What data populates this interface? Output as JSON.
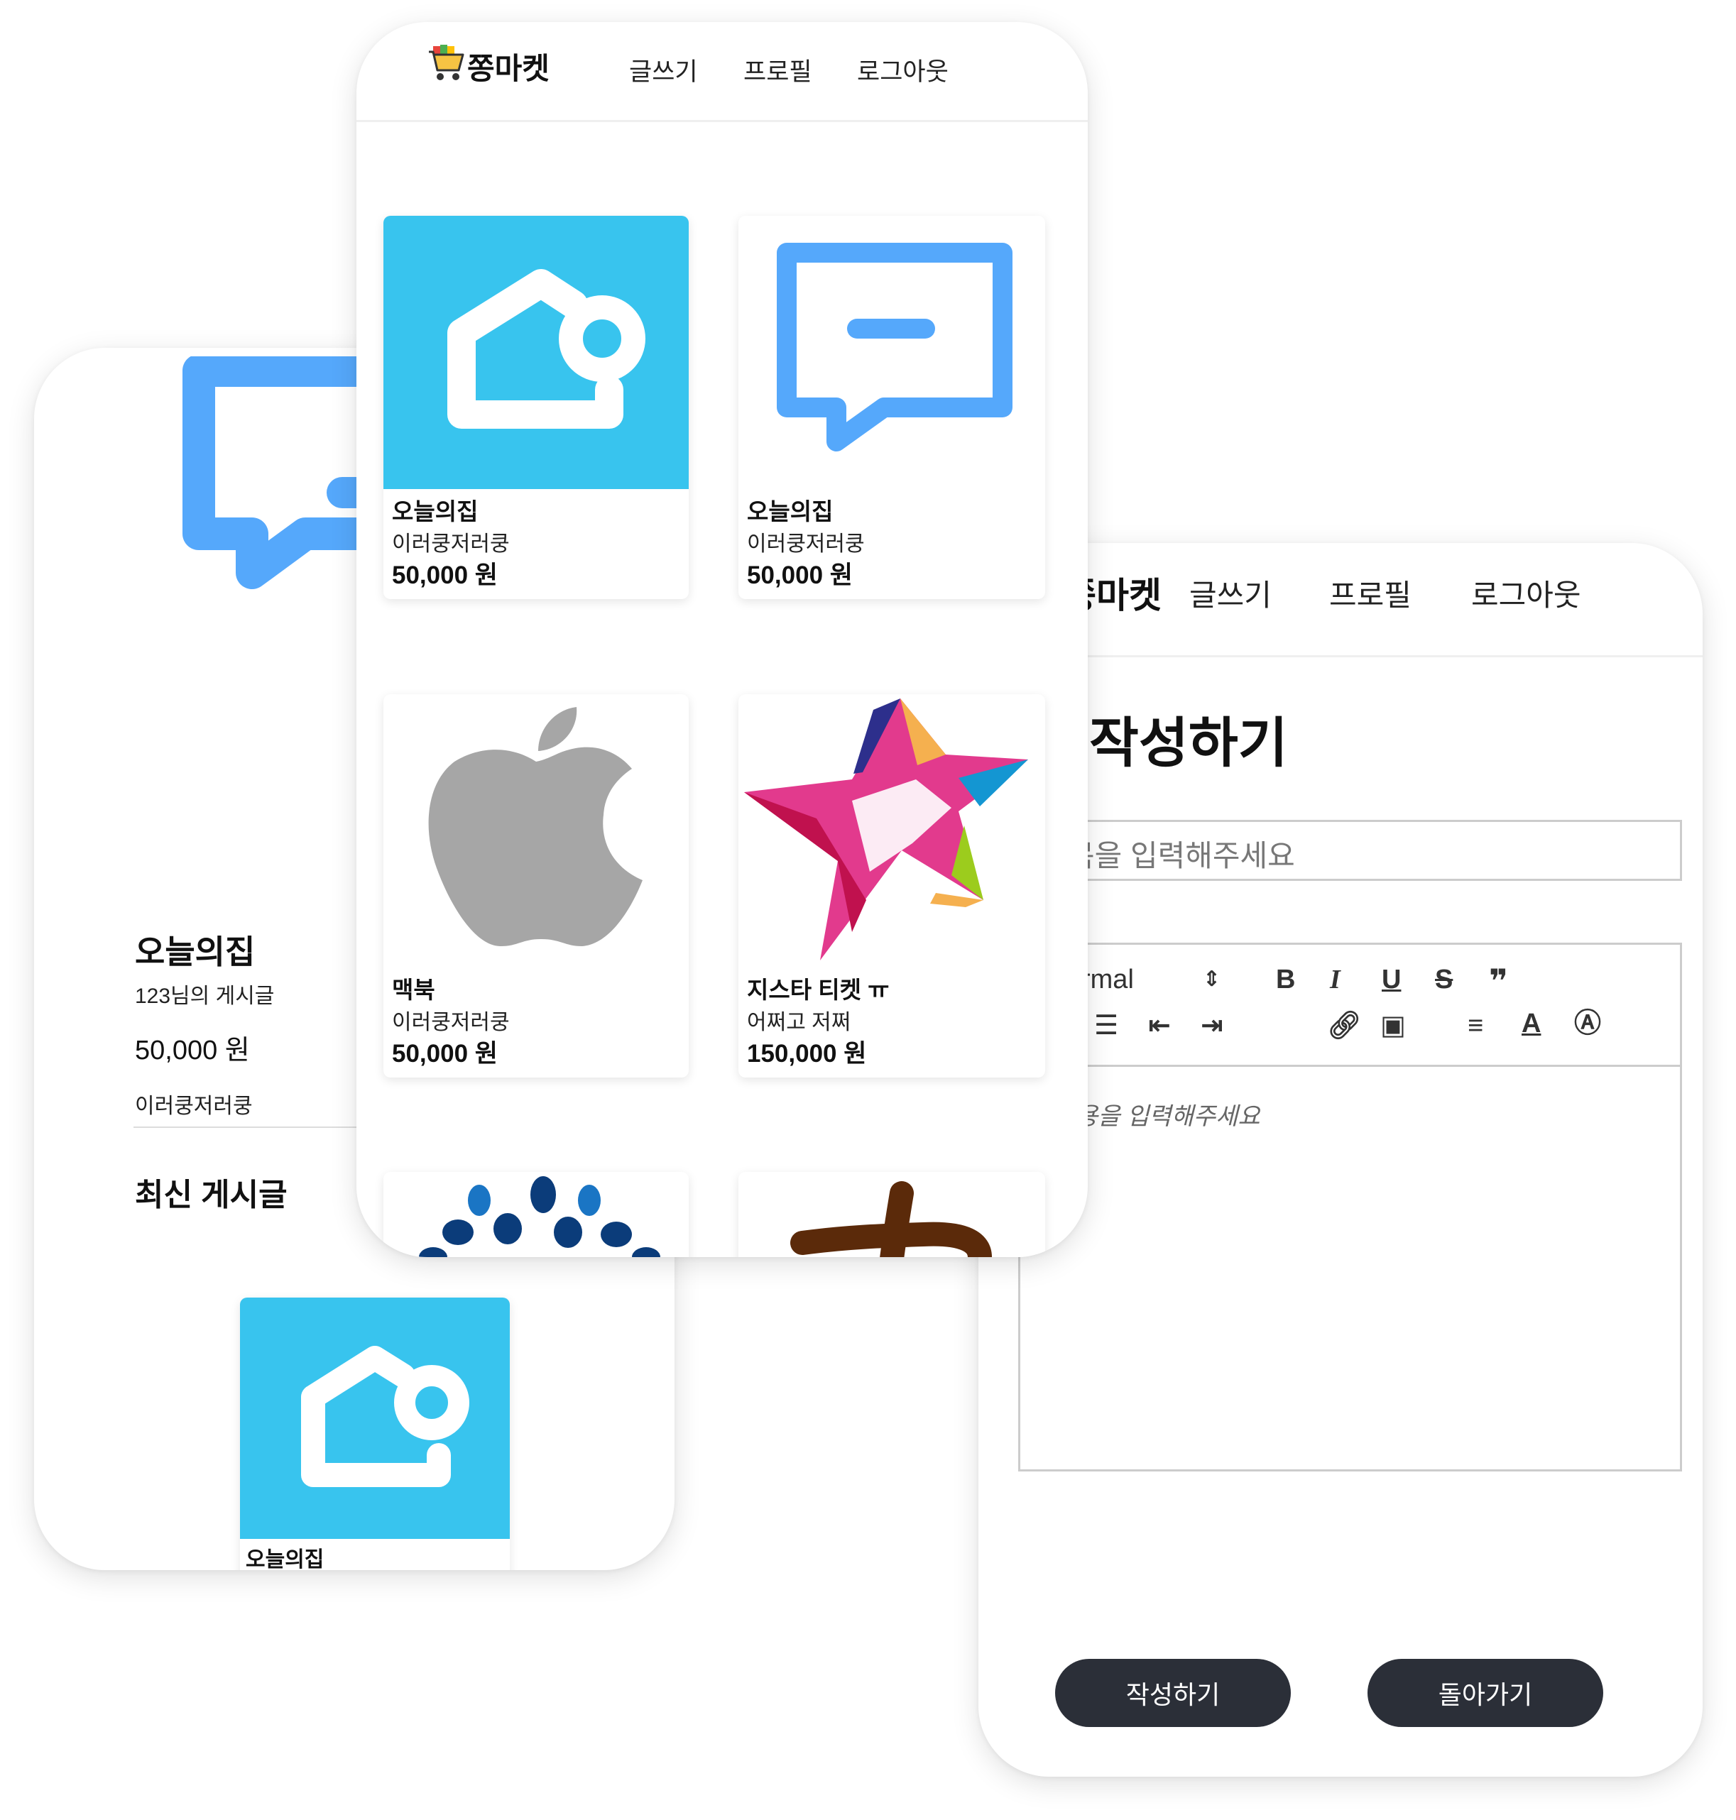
{
  "brand": {
    "name": "쫑마켓"
  },
  "nav": {
    "write": "글쓰기",
    "profile": "프로필",
    "logout": "로그아웃"
  },
  "list_page": {
    "cards": [
      {
        "title": "오늘의집",
        "subtitle": "이러쿵저러쿵",
        "price": "50,000 원",
        "image": "house-logo"
      },
      {
        "title": "오늘의집",
        "subtitle": "이러쿵저러쿵",
        "price": "50,000 원",
        "image": "chat-bubble-logo"
      },
      {
        "title": "맥북",
        "subtitle": "이러쿵저러쿵",
        "price": "50,000 원",
        "image": "apple-logo"
      },
      {
        "title": "지스타 티켓 ㅠ",
        "subtitle": "어쩌고 저쩌",
        "price": "150,000 원",
        "image": "star-logo"
      }
    ]
  },
  "detail_page": {
    "title": "오늘의집",
    "author": "123님의 게시글",
    "price": "50,000 원",
    "description": "이러쿵저러쿵",
    "latest_heading": "최신 게시글",
    "latest_card_title": "오늘의집"
  },
  "write_page": {
    "heading": "작성하기",
    "title_placeholder": "목을 입력해주세요",
    "content_placeholder": "용을 입력해주세요",
    "format_select": "rmal",
    "submit_label": "작성하기",
    "back_label": "돌아가기"
  },
  "colors": {
    "sky": "#38c4ee",
    "blue": "#55a8fb",
    "dark_button": "#2b2f38",
    "apple_gray": "#a6a6a6"
  }
}
